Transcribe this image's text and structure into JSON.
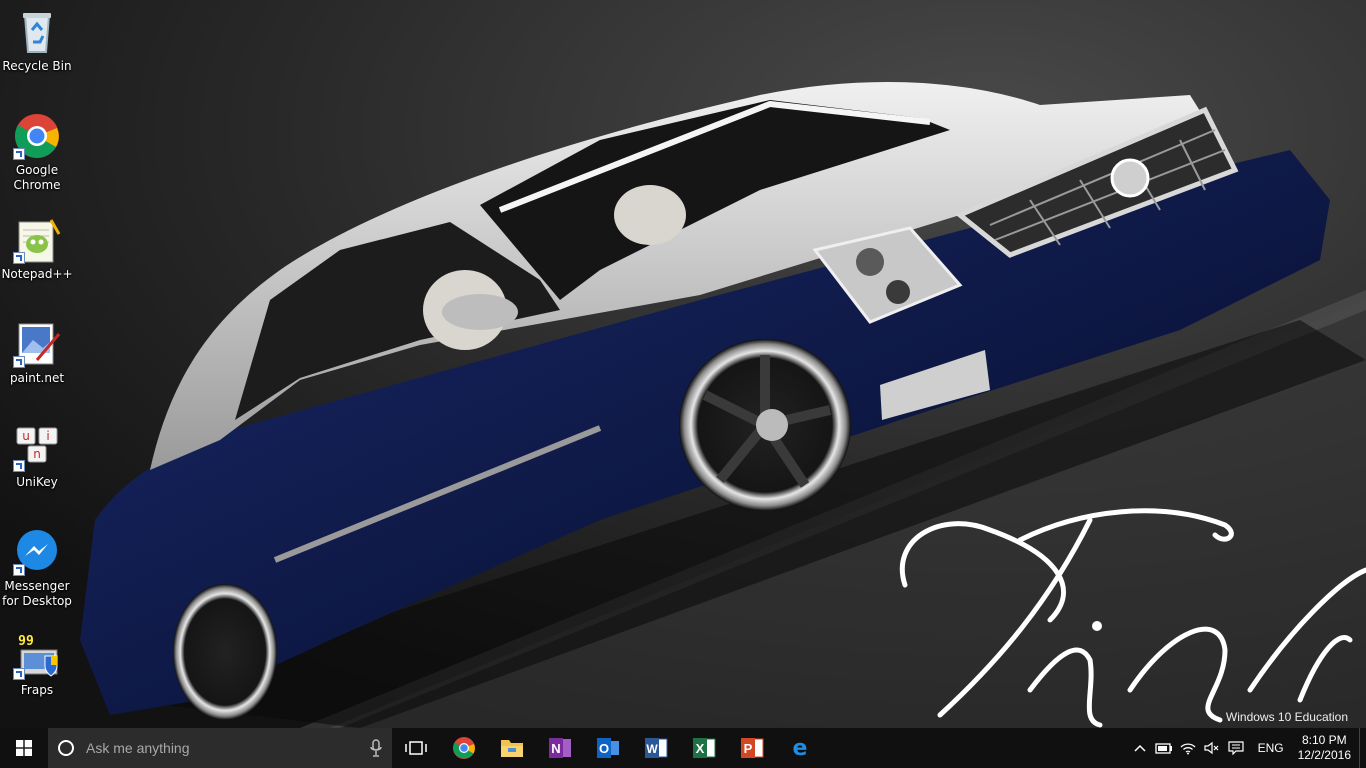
{
  "desktop": {
    "icons": [
      {
        "label": "Recycle Bin",
        "icon": "recycle-bin-icon"
      },
      {
        "label": "Google Chrome",
        "icon": "chrome-icon"
      },
      {
        "label": "Notepad++",
        "icon": "notepad-plus-plus-icon"
      },
      {
        "label": "paint.net",
        "icon": "paint-net-icon"
      },
      {
        "label": "UniKey",
        "icon": "unikey-icon"
      },
      {
        "label": "Messenger for Desktop",
        "icon": "messenger-icon"
      },
      {
        "label": "Fraps",
        "icon": "fraps-icon"
      }
    ],
    "fraps_badge": "99",
    "unikey_letters": [
      "u",
      "i",
      "n"
    ]
  },
  "wallpaper": {
    "signature": "Vinh",
    "car_color": "#101c4e",
    "roof_color": "#c9c9c9"
  },
  "watermark": "Windows 10 Education",
  "taskbar": {
    "search_placeholder": "Ask me anything",
    "pinned": [
      {
        "name": "task-view",
        "icon": "task-view-icon"
      },
      {
        "name": "chrome",
        "icon": "chrome-icon"
      },
      {
        "name": "file-explorer",
        "icon": "folder-icon"
      },
      {
        "name": "onenote",
        "icon": "onenote-icon",
        "letter": "N",
        "color": "#7a2c9e"
      },
      {
        "name": "outlook",
        "icon": "outlook-icon",
        "letter": "O",
        "color": "#0f63c4"
      },
      {
        "name": "word",
        "icon": "word-icon",
        "letter": "W",
        "color": "#2b5797"
      },
      {
        "name": "excel",
        "icon": "excel-icon",
        "letter": "X",
        "color": "#1e7145"
      },
      {
        "name": "powerpoint",
        "icon": "powerpoint-icon",
        "letter": "P",
        "color": "#d24726"
      },
      {
        "name": "edge",
        "icon": "edge-icon",
        "letter": "e",
        "color": "#1f8ce6"
      }
    ],
    "tray": {
      "language": "ENG",
      "time": "8:10 PM",
      "date": "12/2/2016"
    }
  },
  "colors": {
    "taskbar_bg": "#101010",
    "search_bg": "#2c2c2c",
    "accent": "#1f8ce6"
  }
}
